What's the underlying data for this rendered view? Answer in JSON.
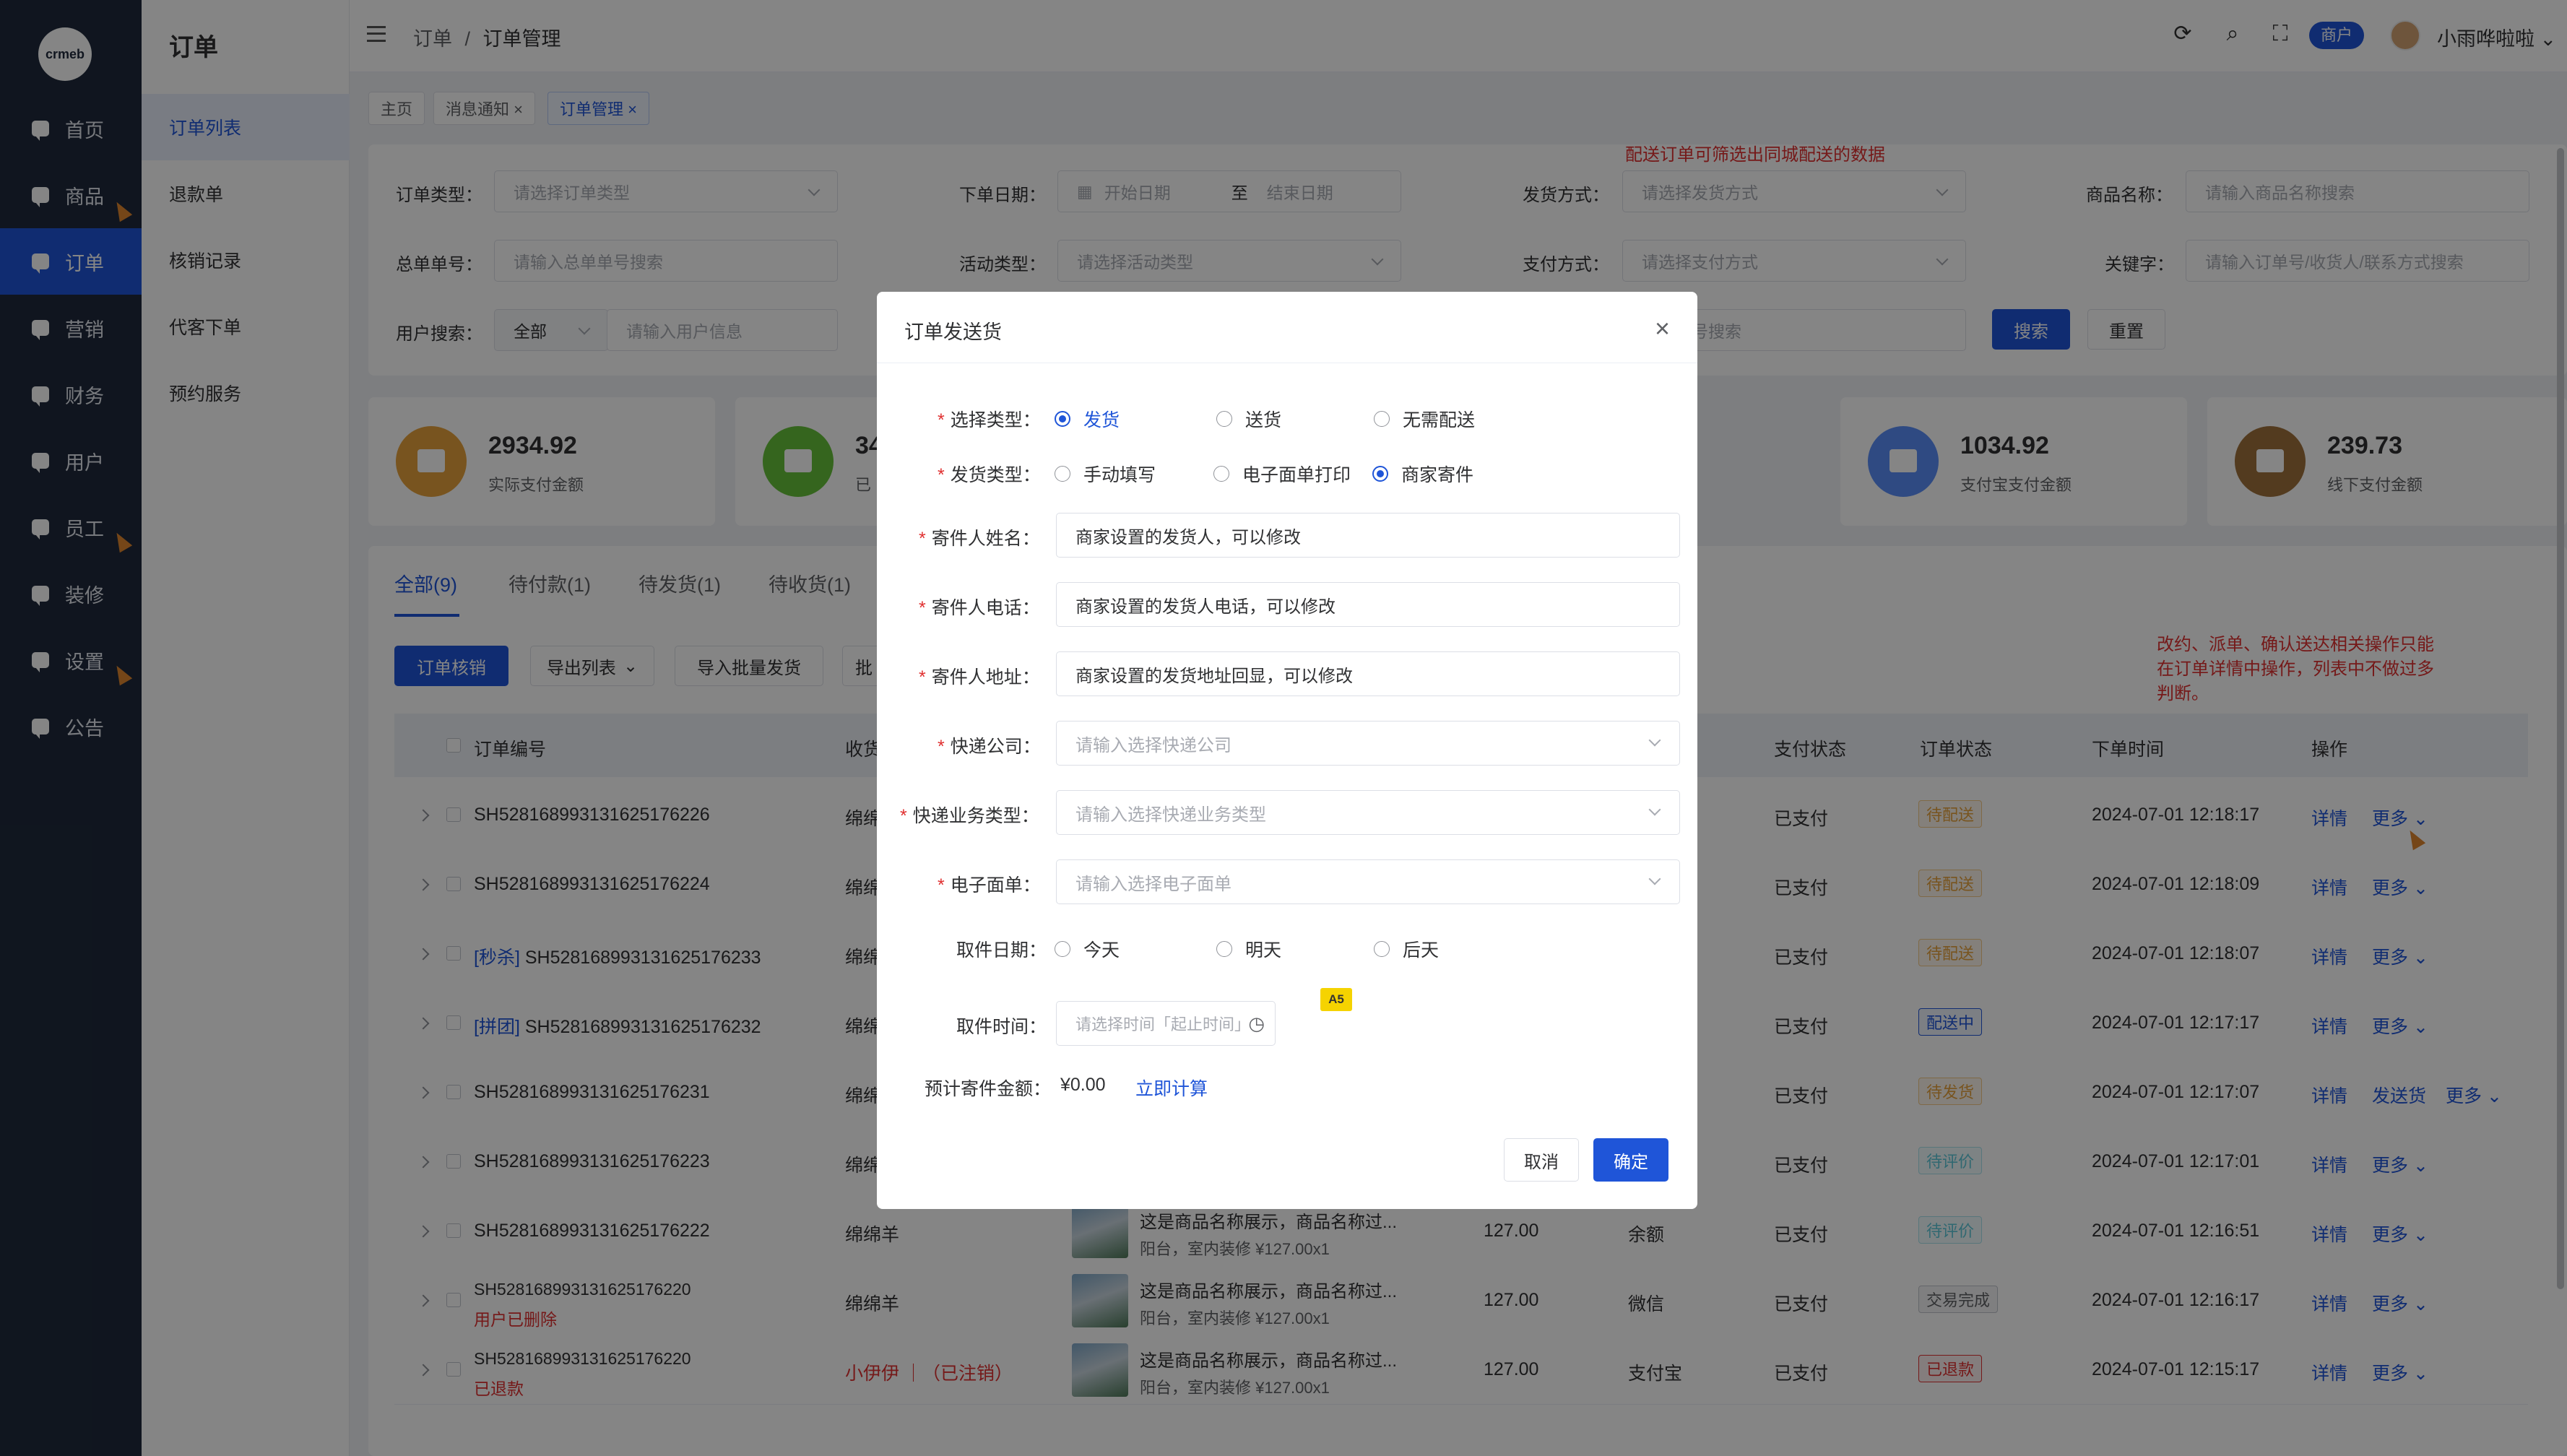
{
  "sidebar": {
    "logo": "crmeb",
    "items": [
      {
        "label": "首页"
      },
      {
        "label": "商品"
      },
      {
        "label": "订单"
      },
      {
        "label": "营销"
      },
      {
        "label": "财务"
      },
      {
        "label": "用户"
      },
      {
        "label": "员工"
      },
      {
        "label": "装修"
      },
      {
        "label": "设置"
      },
      {
        "label": "公告"
      }
    ]
  },
  "submenu": {
    "title": "订单",
    "items": [
      {
        "label": "订单列表"
      },
      {
        "label": "退款单"
      },
      {
        "label": "核销记录"
      },
      {
        "label": "代客下单"
      },
      {
        "label": "预约服务"
      }
    ]
  },
  "header": {
    "breadcrumb_parent": "订单",
    "breadcrumb_sep": "/",
    "breadcrumb_current": "订单管理",
    "shop_badge": "商户",
    "username": "小雨哗啦啦"
  },
  "tabs": [
    {
      "label": "主页"
    },
    {
      "label": "消息通知 ×"
    },
    {
      "label": "订单管理 ×"
    }
  ],
  "filters": {
    "order_type_label": "订单类型：",
    "order_type_ph": "请选择订单类型",
    "order_date_label": "下单日期：",
    "start_date_ph": "开始日期",
    "date_sep": "至",
    "end_date_ph": "结束日期",
    "ship_method_label": "发货方式：",
    "ship_method_ph": "请选择发货方式",
    "product_name_label": "商品名称：",
    "product_name_ph": "请输入商品名称搜索",
    "total_order_label": "总单单号：",
    "total_order_ph": "请输入总单单号搜索",
    "activity_label": "活动类型：",
    "activity_ph": "请选择活动类型",
    "pay_method_label": "支付方式：",
    "pay_method_ph": "请选择支付方式",
    "keyword_label": "关键字：",
    "keyword_ph": "请输入订单号/收货人/联系方式搜索",
    "user_search_label": "用户搜索：",
    "user_search_scope": "全部",
    "user_search_ph": "请输入用户信息",
    "tracking_ph": "快递单号搜索",
    "search_button": "搜索",
    "reset_button": "重置",
    "note_delivery": "配送订单可筛选出同城配送的数据"
  },
  "stats": [
    {
      "value": "2934.92",
      "label": "实际支付金额",
      "color": "#e6a23c"
    },
    {
      "value": "34",
      "label": "已",
      "color": "#67c23a"
    },
    {
      "value": "1034.92",
      "label": "支付宝支付金额",
      "color": "#5b8ff9"
    },
    {
      "value": "239.73",
      "label": "线下支付金额",
      "color": "#a0723c"
    }
  ],
  "order_tabs": [
    {
      "label": "全部(9)"
    },
    {
      "label": "待付款(1)"
    },
    {
      "label": "待发货(1)"
    },
    {
      "label": "待收货(1)"
    }
  ],
  "actions": {
    "verify": "订单核销",
    "export": "导出列表",
    "import_ship": "导入批量发货",
    "batch": "批"
  },
  "note_ops": [
    "改约、派单、确认送达相关操作只能",
    "在订单详情中操作，列表中不做过多",
    "判断。"
  ],
  "table": {
    "headers": {
      "order_no": "订单编号",
      "receiver": "收货",
      "pay_status": "支付状态",
      "order_status": "订单状态",
      "order_time": "下单时间",
      "ops": "操作"
    },
    "rows": [
      {
        "prefix": "",
        "order_no": "SH528168993131625176226",
        "sub": "",
        "receiver": "绵绵",
        "product": "",
        "spec": "",
        "price": "",
        "pay_method": "",
        "pay_status": "已支付",
        "status": "待配送",
        "status_style": "orange",
        "time": "2024-07-01 12:18:17",
        "detail": "详情",
        "extra": "",
        "more": "更多"
      },
      {
        "prefix": "",
        "order_no": "SH528168993131625176224",
        "sub": "",
        "receiver": "绵绵",
        "product": "",
        "spec": "",
        "price": "",
        "pay_method": "",
        "pay_status": "已支付",
        "status": "待配送",
        "status_style": "orange",
        "time": "2024-07-01 12:18:09",
        "detail": "详情",
        "extra": "",
        "more": "更多"
      },
      {
        "prefix": "[秒杀]",
        "order_no": "SH528168993131625176233",
        "sub": "",
        "receiver": "绵绵",
        "product": "",
        "spec": "",
        "price": "",
        "pay_method": "",
        "pay_status": "已支付",
        "status": "待配送",
        "status_style": "orange",
        "time": "2024-07-01 12:18:07",
        "detail": "详情",
        "extra": "",
        "more": "更多"
      },
      {
        "prefix": "[拼团]",
        "order_no": "SH528168993131625176232",
        "sub": "",
        "receiver": "绵绵",
        "product": "",
        "spec": "",
        "price": "",
        "pay_method": "",
        "pay_status": "已支付",
        "status": "配送中",
        "status_style": "blue",
        "time": "2024-07-01 12:17:17",
        "detail": "详情",
        "extra": "",
        "more": "更多"
      },
      {
        "prefix": "",
        "order_no": "SH528168993131625176231",
        "sub": "",
        "receiver": "绵绵",
        "product": "",
        "spec": "",
        "price": "",
        "pay_method": "",
        "pay_status": "已支付",
        "status": "待发货",
        "status_style": "orange",
        "time": "2024-07-01 12:17:07",
        "detail": "详情",
        "extra": "发送货",
        "more": "更多"
      },
      {
        "prefix": "",
        "order_no": "SH528168993131625176223",
        "sub": "",
        "receiver": "绵绵",
        "product": "",
        "spec": "",
        "price": "",
        "pay_method": "",
        "pay_status": "已支付",
        "status": "待评价",
        "status_style": "cyan",
        "time": "2024-07-01 12:17:01",
        "detail": "详情",
        "extra": "",
        "more": "更多"
      },
      {
        "prefix": "",
        "order_no": "SH528168993131625176222",
        "sub": "",
        "receiver": "绵绵羊",
        "product": "这是商品名称展示，商品名称过...",
        "spec": "阳台，室内装修   ¥127.00x1",
        "price": "127.00",
        "pay_method": "余额",
        "pay_status": "已支付",
        "status": "待评价",
        "status_style": "cyan",
        "time": "2024-07-01 12:16:51",
        "detail": "详情",
        "extra": "",
        "more": "更多"
      },
      {
        "prefix": "",
        "order_no": "SH528168993131625176220",
        "sub": "用户已删除",
        "receiver": "绵绵羊",
        "product": "这是商品名称展示，商品名称过...",
        "spec": "阳台，室内装修   ¥127.00x1",
        "price": "127.00",
        "pay_method": "微信",
        "pay_status": "已支付",
        "status": "交易完成",
        "status_style": "gray",
        "time": "2024-07-01 12:16:17",
        "detail": "详情",
        "extra": "",
        "more": "更多"
      },
      {
        "prefix": "",
        "order_no": "SH528168993131625176220",
        "sub": "已退款",
        "receiver": "小伊伊 ｜（已注销）",
        "product": "这是商品名称展示，商品名称过...",
        "spec": "阳台，室内装修   ¥127.00x1",
        "price": "127.00",
        "pay_method": "支付宝",
        "pay_status": "已支付",
        "status": "已退款",
        "status_style": "red",
        "time": "2024-07-01 12:15:17",
        "detail": "详情",
        "extra": "",
        "more": "更多"
      }
    ]
  },
  "modal": {
    "title": "订单发送货",
    "select_type_label": "选择类型：",
    "select_type_options": [
      "发货",
      "送货",
      "无需配送"
    ],
    "ship_type_label": "发货类型：",
    "ship_type_options": [
      "手动填写",
      "电子面单打印",
      "商家寄件"
    ],
    "sender_name_label": "寄件人姓名：",
    "sender_name_value": "商家设置的发货人，可以修改",
    "sender_phone_label": "寄件人电话：",
    "sender_phone_value": "商家设置的发货人电话，可以修改",
    "sender_addr_label": "寄件人地址：",
    "sender_addr_value": "商家设置的发货地址回显，可以修改",
    "courier_label": "快递公司：",
    "courier_ph": "请输入选择快递公司",
    "service_label": "快递业务类型：",
    "service_ph": "请输入选择快递业务类型",
    "waybill_label": "电子面单：",
    "waybill_ph": "请输入选择电子面单",
    "pickup_date_label": "取件日期：",
    "pickup_date_options": [
      "今天",
      "明天",
      "后天"
    ],
    "pickup_time_label": "取件时间：",
    "pickup_time_ph": "请选择时间「起止时间」",
    "size_badge": "A5",
    "estimate_label": "预计寄件金额：",
    "estimate_value": "¥0.00",
    "estimate_link": "立即计算",
    "cancel_button": "取消",
    "confirm_button": "确定"
  },
  "colors": {
    "primary": "#1f55d8",
    "sidebar_bg": "#1f2a3c",
    "danger": "#e03030"
  }
}
